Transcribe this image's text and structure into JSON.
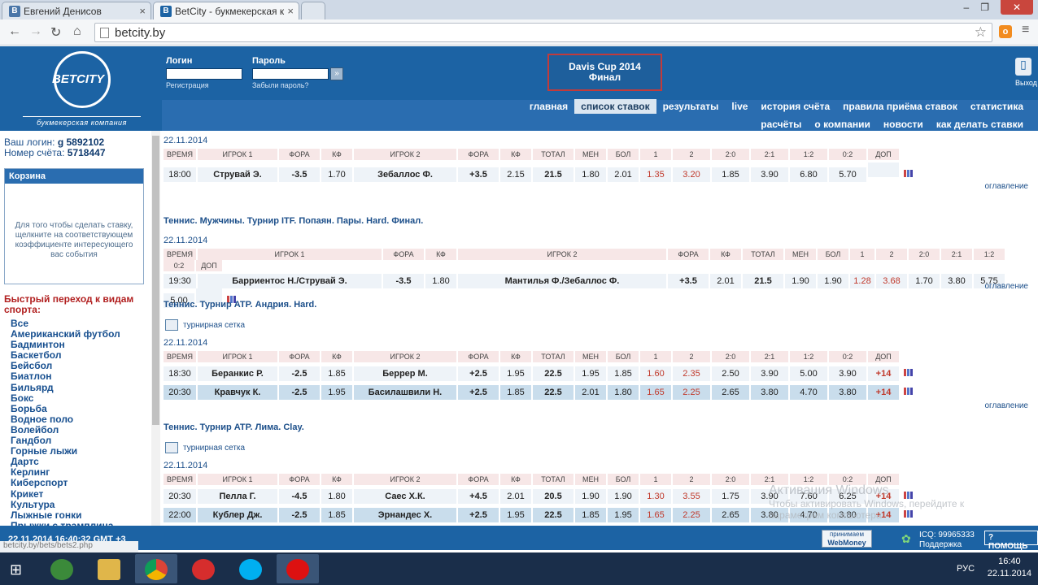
{
  "browser": {
    "tabs": [
      {
        "label": "Евгений Денисов",
        "favicon": "В"
      },
      {
        "label": "BetCity - букмекерская к",
        "favicon": "B"
      }
    ],
    "url": "betcity.by"
  },
  "header": {
    "logo_name": "BETCITY",
    "logo_sub": "букмекерская компания",
    "login_label": "Логин",
    "password_label": "Пароль",
    "register_link": "Регистрация",
    "forgot_link": "Забыли пароль?",
    "go_glyph": "»",
    "promo_line1": "Davis Cup 2014",
    "promo_line2": "Финал",
    "exit_label": "Выход"
  },
  "menu_top": [
    "главная",
    "список ставок",
    "результаты",
    "live",
    "история счёта",
    "правила приёма ставок",
    "статистика"
  ],
  "menu_bottom": [
    "расчёты",
    "о компании",
    "новости",
    "как делать ставки"
  ],
  "sidebar": {
    "login_prefix": "Ваш логин:",
    "login_value": "g 5892102",
    "account_prefix": "Номер счёта:",
    "account_value": "5718447",
    "basket_title": "Корзина",
    "basket_text": "Для того чтобы сделать ставку, щелкните на соответствующем коэффициенте интересующего вас события",
    "quick_title": "Быстрый переход к видам спорта:",
    "sports": [
      "Все",
      "Американский футбол",
      "Бадминтон",
      "Баскетбол",
      "Бейсбол",
      "Биатлон",
      "Бильярд",
      "Бокс",
      "Борьба",
      "Водное поло",
      "Волейбол",
      "Гандбол",
      "Горные лыжи",
      "Дартс",
      "Керлинг",
      "Киберспорт",
      "Крикет",
      "Культура",
      "Лыжные гонки",
      "Прыжки с трамплина"
    ]
  },
  "headers": [
    "Время",
    "Игрок 1",
    "Фора",
    "Кф",
    "Игрок 2",
    "Фора",
    "Кф",
    "Тотал",
    "Мен",
    "Бол",
    "1",
    "2",
    "2:0",
    "2:1",
    "1:2",
    "0:2",
    "Доп"
  ],
  "events": [
    {
      "title": "",
      "date": "22.11.2014",
      "grid_link": "",
      "rows": [
        [
          "18:00",
          "Струвай Э.",
          "-3.5",
          "1.70",
          "Зебаллос Ф.",
          "+3.5",
          "2.15",
          "21.5",
          "1.80",
          "2.01",
          "1.35",
          "3.20",
          "1.85",
          "3.90",
          "6.80",
          "5.70",
          ""
        ]
      ]
    },
    {
      "title": "Теннис. Мужчины. Турнир ITF. Попаян. Пары. Hard. Финал.",
      "date": "22.11.2014",
      "grid_link": "",
      "rows": [
        [
          "19:30",
          "Барриентос Н./Струвай Э.",
          "-3.5",
          "1.80",
          "Мантилья Ф./Зебаллос Ф.",
          "+3.5",
          "2.01",
          "21.5",
          "1.90",
          "1.90",
          "1.28",
          "3.68",
          "1.70",
          "3.80",
          "5.75",
          "5.00",
          ""
        ]
      ]
    },
    {
      "title": "Теннис. Турнир ATP. Андрия. Hard.",
      "date": "22.11.2014",
      "grid_link": "турнирная сетка",
      "rows": [
        [
          "18:30",
          "Беранкис Р.",
          "-2.5",
          "1.85",
          "Беррер М.",
          "+2.5",
          "1.95",
          "22.5",
          "1.95",
          "1.85",
          "1.60",
          "2.35",
          "2.50",
          "3.90",
          "5.00",
          "3.90",
          "+14"
        ],
        [
          "20:30",
          "Кравчук К.",
          "-2.5",
          "1.95",
          "Басилашвили Н.",
          "+2.5",
          "1.85",
          "22.5",
          "2.01",
          "1.80",
          "1.65",
          "2.25",
          "2.65",
          "3.80",
          "4.70",
          "3.80",
          "+14"
        ]
      ]
    },
    {
      "title": "Теннис. Турнир ATP. Лима. Clay.",
      "date": "22.11.2014",
      "grid_link": "турнирная сетка",
      "rows": [
        [
          "20:30",
          "Пелла Г.",
          "-4.5",
          "1.80",
          "Саес Х.К.",
          "+4.5",
          "2.01",
          "20.5",
          "1.90",
          "1.90",
          "1.30",
          "3.55",
          "1.75",
          "3.90",
          "7.60",
          "6.25",
          "+14"
        ],
        [
          "22:00",
          "Кублер Дж.",
          "-2.5",
          "1.85",
          "Эрнандес Х.",
          "+2.5",
          "1.95",
          "22.5",
          "1.85",
          "1.95",
          "1.65",
          "2.25",
          "2.65",
          "3.80",
          "4.70",
          "3.80",
          "+14"
        ]
      ]
    }
  ],
  "contents_link": "оглавление",
  "footer": {
    "datetime": "22.11.2014 16:40:32 GMT +3",
    "webmoney_top": "принимаем",
    "webmoney": "WebMoney",
    "icq": "ICQ: 99965333",
    "support": "Поддержка",
    "help": "ПОМОЩЬ"
  },
  "status_url": "betcity.by/bets/bets2.php",
  "watermark": {
    "title": "Активация Windows",
    "line1": "Чтобы активировать Windows, перейдите к",
    "line2": "параметрам компьютера"
  },
  "taskbar": {
    "lang": "РУС",
    "time": "16:40",
    "date": "22.11.2014"
  },
  "colors": {
    "brand": "#1c63a4",
    "row": "#eef3f8",
    "row_alt": "#c9ddec",
    "header_cell": "#f7e7e7",
    "accent_red": "#c0392b"
  }
}
